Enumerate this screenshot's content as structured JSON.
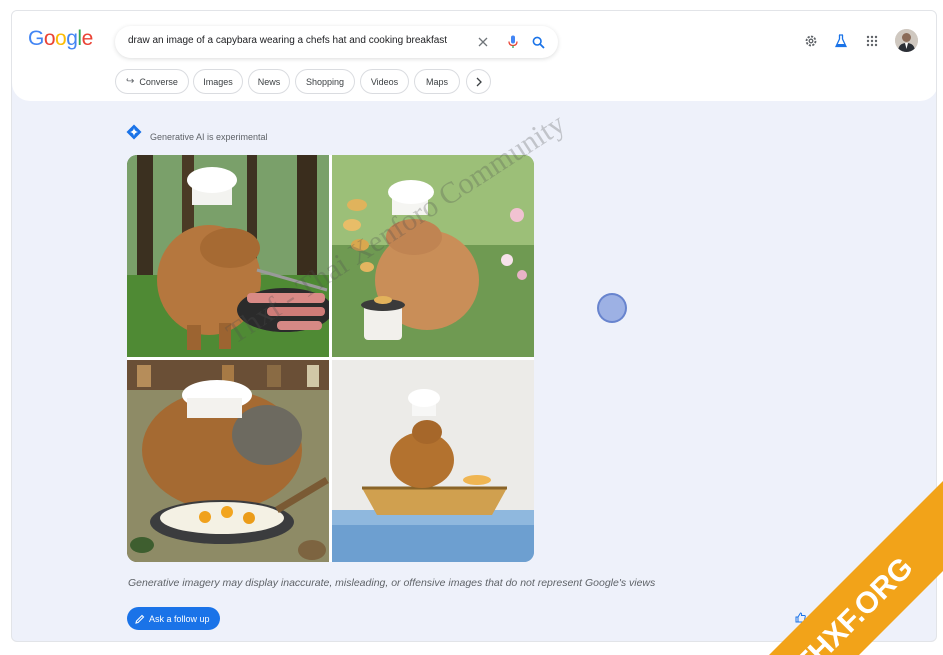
{
  "logo": {
    "text": "Google",
    "letters": [
      "G",
      "o",
      "o",
      "g",
      "l",
      "e"
    ],
    "colors": [
      "#4285f4",
      "#ea4335",
      "#fbbc05",
      "#4285f4",
      "#34a853",
      "#ea4335"
    ]
  },
  "search": {
    "query": "draw an image of a capybara wearing a chefs hat and cooking breakfast"
  },
  "header_icons": [
    "clear-icon",
    "mic-icon",
    "search-icon",
    "settings-icon",
    "labs-icon",
    "apps-icon",
    "avatar"
  ],
  "chips": [
    "Converse",
    "Images",
    "News",
    "Shopping",
    "Videos",
    "Maps"
  ],
  "ai_label": "Generative AI is experimental",
  "gallery": {
    "images": [
      "capybara-chef-grilling-bacon-forest",
      "capybara-chef-flipping-pancakes-garden",
      "capybara-chef-frying-eggs-kitchen",
      "capybara-chef-in-boat-watercolor"
    ]
  },
  "disclaimer": "Generative imagery may display inaccurate, misleading, or offensive images that do not represent Google's views",
  "followup_label": "Ask a follow up",
  "watermark": "Thxf - Thai Xenforo Community",
  "ribbon_text": "THXF.ORG",
  "accent": "#1a73e8"
}
